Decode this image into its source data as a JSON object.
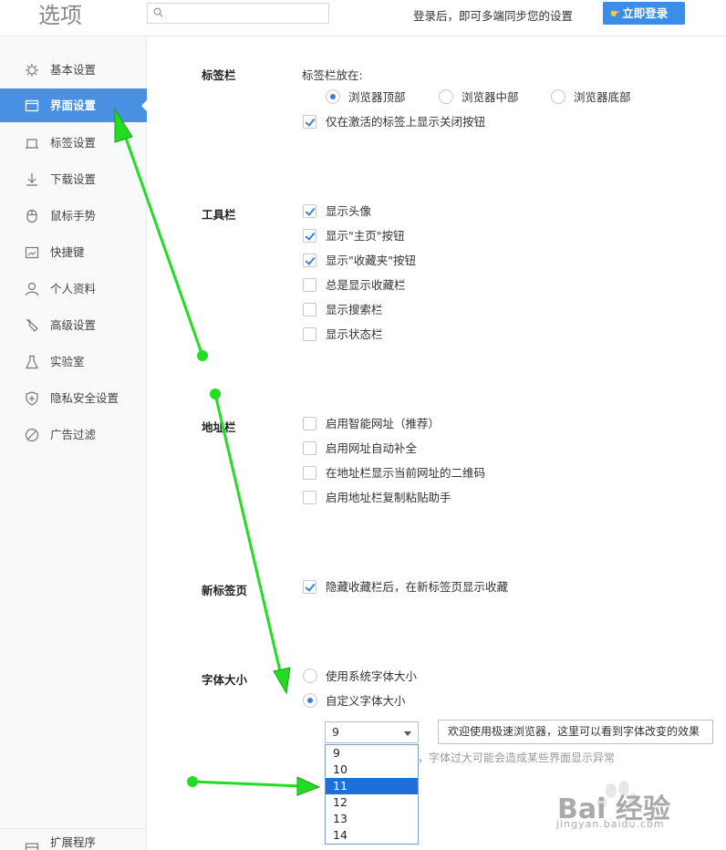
{
  "header": {
    "title": "选项",
    "search_placeholder": "",
    "login_hint": "登录后，即可多端同步您的设置",
    "login_button": "立即登录"
  },
  "sidebar": {
    "items": [
      {
        "label": "基本设置",
        "icon": "gear-icon"
      },
      {
        "label": "界面设置",
        "icon": "window-icon",
        "active": true
      },
      {
        "label": "标签设置",
        "icon": "tab-icon"
      },
      {
        "label": "下载设置",
        "icon": "download-icon"
      },
      {
        "label": "鼠标手势",
        "icon": "mouse-icon"
      },
      {
        "label": "快捷键",
        "icon": "keyboard-icon"
      },
      {
        "label": "个人资料",
        "icon": "user-icon"
      },
      {
        "label": "高级设置",
        "icon": "tool-icon"
      },
      {
        "label": "实验室",
        "icon": "flask-icon"
      },
      {
        "label": "隐私安全设置",
        "icon": "shield-icon"
      },
      {
        "label": "广告过滤",
        "icon": "block-icon"
      }
    ],
    "footer_label": "扩展程序"
  },
  "tabbar": {
    "label": "标签栏",
    "position_label": "标签栏放在:",
    "positions": [
      "浏览器顶部",
      "浏览器中部",
      "浏览器底部"
    ],
    "selected_position": 0,
    "close_btn_label": "仅在激活的标签上显示关闭按钮",
    "close_btn_checked": true
  },
  "toolbar": {
    "label": "工具栏",
    "options": [
      {
        "label": "显示头像",
        "checked": true
      },
      {
        "label": "显示\"主页\"按钮",
        "checked": true
      },
      {
        "label": "显示\"收藏夹\"按钮",
        "checked": true
      },
      {
        "label": "总是显示收藏栏",
        "checked": false
      },
      {
        "label": "显示搜索栏",
        "checked": false
      },
      {
        "label": "显示状态栏",
        "checked": false
      }
    ]
  },
  "addressbar": {
    "label": "地址栏",
    "options": [
      {
        "label": "启用智能网址（推荐）",
        "checked": false
      },
      {
        "label": "启用网址自动补全",
        "checked": false
      },
      {
        "label": "在地址栏显示当前网址的二维码",
        "checked": false
      },
      {
        "label": "启用地址栏复制粘贴助手",
        "checked": false
      }
    ]
  },
  "newtab": {
    "label": "新标签页",
    "option": "隐藏收藏栏后，在新标签页显示收藏",
    "checked": true
  },
  "fontsize": {
    "label": "字体大小",
    "options": [
      "使用系统字体大小",
      "自定义字体大小"
    ],
    "selected": 1,
    "select_value": "9",
    "preview_text": "欢迎使用极速浏览器，这里可以看到字体改变的效果",
    "hint": "，字体过大可能会造成某些界面显示异常",
    "dropdown_options": [
      "9",
      "10",
      "11",
      "12",
      "13",
      "14"
    ],
    "highlighted_option": 2
  },
  "watermark": {
    "text": "Bai  经验",
    "sub": "jingyan.baidu.com"
  },
  "colors": {
    "accent": "#4a90e2",
    "arrow": "#22dd22",
    "highlight": "#1e6fd9"
  }
}
